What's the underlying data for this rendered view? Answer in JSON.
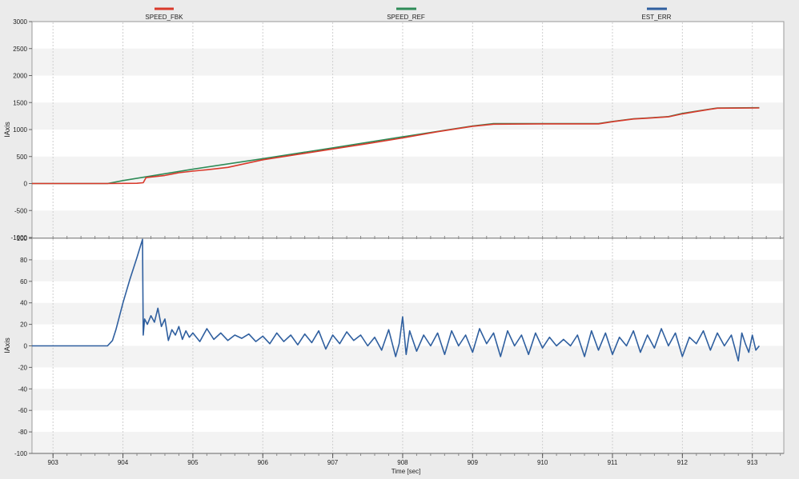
{
  "legend": [
    {
      "name": "SPEED_FBK",
      "color": "#d9392b"
    },
    {
      "name": "SPEED_REF",
      "color": "#2e8b57"
    },
    {
      "name": "EST_ERR",
      "color": "#2f5f9f"
    }
  ],
  "xaxis": {
    "label": "Time [sec]",
    "ticks": [
      "903",
      "904",
      "905",
      "906",
      "907",
      "908",
      "909",
      "910",
      "911",
      "912",
      "913"
    ]
  },
  "chart_data": [
    {
      "type": "line",
      "ylabel": "IAxis",
      "xlim": [
        902.7,
        913.45
      ],
      "ylim": [
        -1000,
        3000
      ],
      "yticks": [
        "3000",
        "2500",
        "2000",
        "1500",
        "1000",
        "500",
        "0",
        "-500",
        "-1000"
      ],
      "grid": true,
      "legend_position": "top",
      "series": [
        {
          "name": "SPEED_REF",
          "color": "#2e8b57",
          "x": [
            902.7,
            903.78,
            904.0,
            904.5,
            905.0,
            906.0,
            907.0,
            908.0,
            909.0,
            909.3,
            910.0,
            910.8,
            911.0,
            911.3,
            911.5,
            911.8,
            912.0,
            912.2,
            912.5,
            913.1
          ],
          "y": [
            0,
            0,
            55,
            160,
            265,
            460,
            660,
            865,
            1065,
            1110,
            1110,
            1110,
            1150,
            1200,
            1215,
            1240,
            1300,
            1340,
            1400,
            1405
          ]
        },
        {
          "name": "SPEED_FBK",
          "color": "#d9392b",
          "x": [
            902.7,
            903.78,
            904.2,
            904.29,
            904.33,
            904.5,
            904.6,
            904.7,
            904.8,
            905.0,
            905.2,
            905.5,
            906.0,
            906.5,
            907.0,
            907.5,
            908.0,
            908.5,
            909.0,
            909.3,
            910.0,
            910.8,
            911.0,
            911.3,
            911.5,
            911.8,
            912.0,
            912.2,
            912.5,
            913.1
          ],
          "y": [
            0,
            0,
            5,
            15,
            110,
            135,
            150,
            175,
            200,
            230,
            255,
            300,
            440,
            540,
            640,
            740,
            845,
            960,
            1060,
            1100,
            1105,
            1105,
            1145,
            1195,
            1210,
            1235,
            1290,
            1335,
            1395,
            1400
          ]
        }
      ]
    },
    {
      "type": "line",
      "ylabel": "IAxis",
      "xlim": [
        902.7,
        913.45
      ],
      "ylim": [
        -100,
        100
      ],
      "yticks": [
        "100",
        "80",
        "60",
        "40",
        "20",
        "0",
        "-20",
        "-40",
        "-60",
        "-80",
        "-100"
      ],
      "grid": true,
      "series": [
        {
          "name": "EST_ERR",
          "color": "#2f5f9f",
          "x": [
            902.7,
            903.78,
            903.85,
            903.9,
            904.0,
            904.1,
            904.2,
            904.28,
            904.29,
            904.31,
            904.35,
            904.4,
            904.45,
            904.5,
            904.55,
            904.6,
            904.65,
            904.7,
            904.75,
            904.8,
            904.85,
            904.9,
            904.95,
            905.0,
            905.1,
            905.2,
            905.3,
            905.4,
            905.5,
            905.6,
            905.7,
            905.8,
            905.9,
            906.0,
            906.1,
            906.2,
            906.3,
            906.4,
            906.5,
            906.6,
            906.7,
            906.8,
            906.9,
            907.0,
            907.1,
            907.2,
            907.3,
            907.4,
            907.5,
            907.6,
            907.7,
            907.8,
            907.9,
            907.95,
            908.0,
            908.05,
            908.1,
            908.2,
            908.3,
            908.4,
            908.5,
            908.6,
            908.7,
            908.8,
            908.9,
            909.0,
            909.1,
            909.2,
            909.3,
            909.4,
            909.5,
            909.6,
            909.7,
            909.8,
            909.9,
            910.0,
            910.1,
            910.2,
            910.3,
            910.4,
            910.5,
            910.6,
            910.7,
            910.8,
            910.9,
            911.0,
            911.1,
            911.2,
            911.3,
            911.4,
            911.5,
            911.6,
            911.7,
            911.8,
            911.9,
            912.0,
            912.1,
            912.2,
            912.3,
            912.4,
            912.5,
            912.6,
            912.7,
            912.8,
            912.85,
            912.9,
            912.95,
            913.0,
            913.05,
            913.1
          ],
          "y": [
            0,
            0,
            5,
            15,
            40,
            62,
            82,
            99,
            10,
            25,
            20,
            28,
            22,
            35,
            18,
            25,
            5,
            15,
            10,
            18,
            6,
            14,
            8,
            12,
            4,
            16,
            6,
            12,
            5,
            10,
            7,
            11,
            4,
            9,
            2,
            12,
            4,
            10,
            1,
            11,
            3,
            14,
            -3,
            10,
            2,
            13,
            5,
            10,
            0,
            8,
            -4,
            15,
            -10,
            2,
            27,
            -8,
            14,
            -5,
            10,
            0,
            12,
            -8,
            14,
            0,
            10,
            -6,
            16,
            2,
            12,
            -10,
            14,
            0,
            10,
            -8,
            12,
            -2,
            8,
            0,
            6,
            0,
            10,
            -10,
            14,
            -4,
            12,
            -8,
            8,
            0,
            14,
            -6,
            10,
            -2,
            16,
            0,
            12,
            -10,
            8,
            2,
            14,
            -4,
            12,
            0,
            10,
            -14,
            12,
            2,
            -6,
            10,
            -4,
            0
          ]
        }
      ]
    }
  ]
}
